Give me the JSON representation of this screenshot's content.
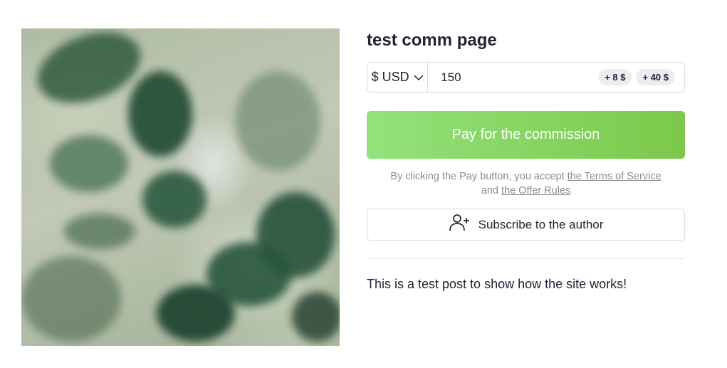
{
  "post": {
    "title": "test comm page",
    "body_text": "This is a test post to show how the site works!"
  },
  "payment": {
    "currency_label": "$ USD",
    "amount_value": "150",
    "quick_add": [
      "+ 8 $",
      "+ 40 $"
    ],
    "pay_label": "Pay for the commission"
  },
  "terms": {
    "prefix": "By clicking the Pay button, you accept",
    "tos_link": "the Terms of Service",
    "and": "and",
    "offer_link": "the Offer Rules"
  },
  "subscribe": {
    "label": "Subscribe to the author"
  },
  "colors": {
    "pay_gradient_start": "#93e27b",
    "pay_gradient_end": "#7cc84a",
    "text": "#232336",
    "muted": "#8b8b96"
  }
}
